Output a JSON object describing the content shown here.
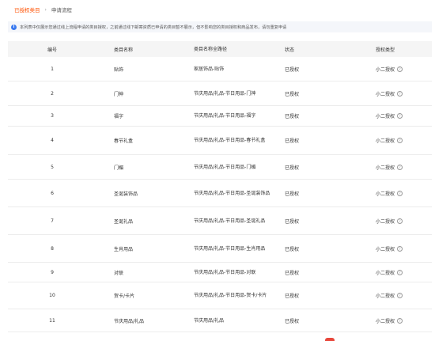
{
  "tabs": {
    "active": "已授权类目",
    "separator": "›",
    "other": "申请流程"
  },
  "notice": {
    "text": "本列表中仅展示您通过线上流程申请的类目授权，之前通过线下邮寄资质已申请的类目暂不展示，但不影响您的类目授权和商品发布，请勿重复申请"
  },
  "table": {
    "headers": {
      "id": "编号",
      "name": "类目名称",
      "path": "类目名称全路径",
      "status": "状态",
      "type": "授权类型"
    },
    "rows": [
      {
        "id": "1",
        "name": "贴饰",
        "path": "家居饰品-贴饰",
        "status": "已授权",
        "type": "小二授权"
      },
      {
        "id": "2",
        "name": "门神",
        "path": "节庆用品/礼品-节日用品-门神",
        "status": "已授权",
        "type": "小二授权"
      },
      {
        "id": "3",
        "name": "福字",
        "path": "节庆用品/礼品-节日用品-福字",
        "status": "已授权",
        "type": "小二授权"
      },
      {
        "id": "4",
        "name": "春节礼盒",
        "path": "节庆用品/礼品-节日用品-春节礼盒",
        "status": "已授权",
        "type": "小二授权"
      },
      {
        "id": "5",
        "name": "门楣",
        "path": "节庆用品/礼品-节日用品-门楣",
        "status": "已授权",
        "type": "小二授权"
      },
      {
        "id": "6",
        "name": "圣诞装饰品",
        "path": "节庆用品/礼品-节日用品-圣诞装饰品",
        "status": "已授权",
        "type": "小二授权"
      },
      {
        "id": "7",
        "name": "圣诞礼品",
        "path": "节庆用品/礼品-节日用品-圣诞礼品",
        "status": "已授权",
        "type": "小二授权"
      },
      {
        "id": "8",
        "name": "生肖用品",
        "path": "节庆用品/礼品-节日用品-生肖用品",
        "status": "已授权",
        "type": "小二授权"
      },
      {
        "id": "9",
        "name": "对联",
        "path": "节庆用品/礼品-节日用品-对联",
        "status": "已授权",
        "type": "小二授权"
      },
      {
        "id": "10",
        "name": "贺卡/卡片",
        "path": "节庆用品/礼品-节日用品-贺卡/卡片",
        "status": "已授权",
        "type": "小二授权"
      },
      {
        "id": "11",
        "name": "节庆用品/礼品",
        "path": "节庆用品/礼品",
        "status": "已授权",
        "type": "小二授权"
      }
    ]
  },
  "icons": {
    "info": "info-icon",
    "help": "question-circle-icon"
  },
  "colors": {
    "accent": "#ff5000",
    "info": "#3a7af0",
    "header_bg": "#f5f5f5"
  }
}
